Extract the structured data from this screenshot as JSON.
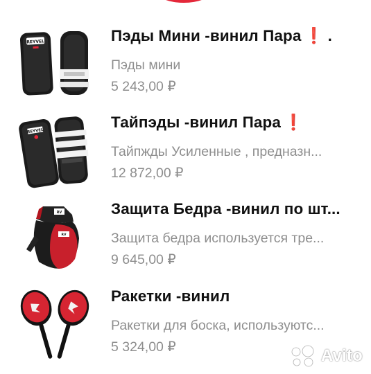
{
  "colors": {
    "title": "#111111",
    "secondary_text": "#8e8e8e",
    "alert": "#e5231b",
    "brand_red": "#e4283a"
  },
  "products": [
    {
      "title": "Пэды Мини -винил Пара",
      "badge_icon": "exclamation-icon",
      "badge": "❗",
      "trailing": ".",
      "description": "Пэды мини",
      "price": "5 243,00 ₽"
    },
    {
      "title": "Тайпэды  -винил Пара",
      "badge_icon": "exclamation-icon",
      "badge": "❗",
      "description": "Тайпжды Усиленные , предназн...",
      "price": "12 872,00 ₽"
    },
    {
      "title": "Защита Бедра -винил по шт...",
      "description": "Защита бедра используется тре...",
      "price": "9 645,00 ₽"
    },
    {
      "title": "Ракетки -винил",
      "description": "Ракетки для боска, используютс...",
      "price": "5 324,00 ₽"
    }
  ],
  "watermark": {
    "icon": "avito-logo-icon",
    "text": "Avito"
  }
}
